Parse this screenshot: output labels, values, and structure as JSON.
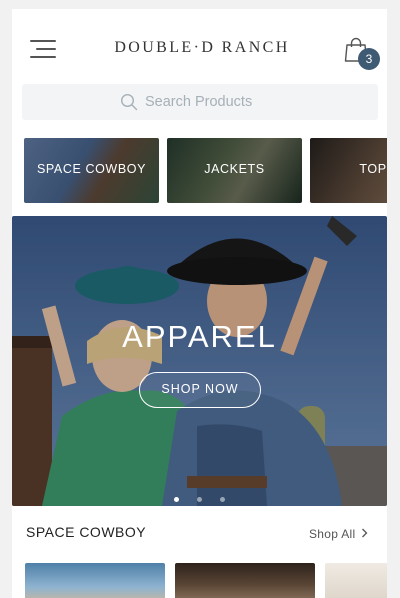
{
  "header": {
    "logo_text": "DOUBLE·D RANCH",
    "cart_count": "3",
    "icons": {
      "menu": "hamburger-menu-icon",
      "cart": "shopping-bag-icon"
    }
  },
  "search": {
    "placeholder": "Search Products"
  },
  "categories": [
    {
      "label": "SPACE COWBOY"
    },
    {
      "label": "JACKETS"
    },
    {
      "label": "TOPS"
    }
  ],
  "hero": {
    "title": "APPAREL",
    "button_label": "SHOP NOW",
    "slide_count": 3,
    "active_slide": 1
  },
  "section": {
    "title": "SPACE COWBOY",
    "link_label": "Shop All"
  },
  "colors": {
    "badge": "#3f5a73",
    "background": "#ffffff"
  }
}
